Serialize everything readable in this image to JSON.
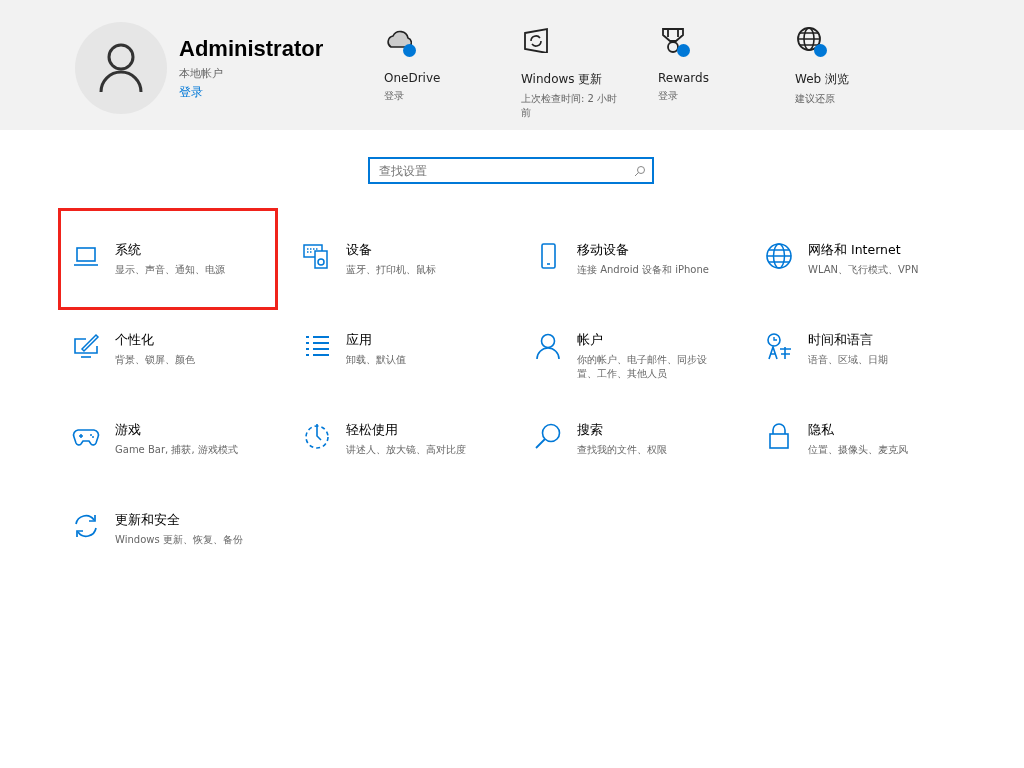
{
  "account": {
    "name": "Administrator",
    "type": "本地帐户",
    "link": "登录"
  },
  "quick_links": [
    {
      "title": "OneDrive",
      "subtitle": "登录",
      "badge": true
    },
    {
      "title": "Windows 更新",
      "subtitle": "上次检查时间: 2 小时前",
      "badge": false
    },
    {
      "title": "Rewards",
      "subtitle": "登录",
      "badge": true
    },
    {
      "title": "Web 浏览",
      "subtitle": "建议还原",
      "badge": true
    }
  ],
  "search": {
    "placeholder": "查找设置"
  },
  "categories": [
    {
      "title": "系统",
      "subtitle": "显示、声音、通知、电源",
      "highlighted": true
    },
    {
      "title": "设备",
      "subtitle": "蓝牙、打印机、鼠标",
      "highlighted": false
    },
    {
      "title": "移动设备",
      "subtitle": "连接 Android 设备和 iPhone",
      "highlighted": false
    },
    {
      "title": "网络和 Internet",
      "subtitle": "WLAN、飞行模式、VPN",
      "highlighted": false
    },
    {
      "title": "个性化",
      "subtitle": "背景、锁屏、颜色",
      "highlighted": false
    },
    {
      "title": "应用",
      "subtitle": "卸载、默认值",
      "highlighted": false
    },
    {
      "title": "帐户",
      "subtitle": "你的帐户、电子邮件、同步设置、工作、其他人员",
      "highlighted": false
    },
    {
      "title": "时间和语言",
      "subtitle": "语音、区域、日期",
      "highlighted": false
    },
    {
      "title": "游戏",
      "subtitle": "Game Bar, 捕获, 游戏模式",
      "highlighted": false
    },
    {
      "title": "轻松使用",
      "subtitle": "讲述人、放大镜、高对比度",
      "highlighted": false
    },
    {
      "title": "搜索",
      "subtitle": "查找我的文件、权限",
      "highlighted": false
    },
    {
      "title": "隐私",
      "subtitle": "位置、摄像头、麦克风",
      "highlighted": false
    },
    {
      "title": "更新和安全",
      "subtitle": "Windows 更新、恢复、备份",
      "highlighted": false
    }
  ]
}
